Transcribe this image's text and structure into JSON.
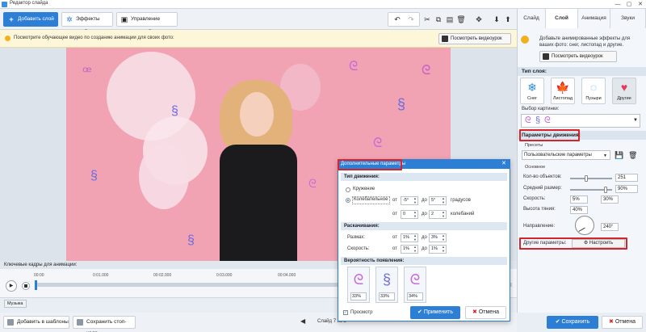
{
  "window": {
    "title": "Редактор слайда",
    "minimize": "—",
    "maximize": "▢",
    "close": "✕"
  },
  "toolbar": {
    "add_layer": "Добавить слой",
    "slide_effects": "Эффекты слайда",
    "camera_control": "Управление камерой",
    "icons": [
      "undo-icon",
      "redo-icon",
      "cut-icon",
      "copy-icon",
      "paste-icon",
      "delete-icon",
      "align-icon",
      "move-down-icon",
      "move-up-icon"
    ]
  },
  "notice": {
    "text": "Посмотрите обучающее видео по созданию анимации для своих фото:",
    "button": "Посмотреть видеоурок"
  },
  "keyframes": {
    "label": "Ключевые кадры для анимации:",
    "ticks": [
      "00:00",
      "0:01.000",
      "00:02.000",
      "0:03.000",
      "00:04.000"
    ],
    "music": "Музыка"
  },
  "bottom": {
    "add_template": "Добавить в шаблоны",
    "save_frame": "Сохранить стоп-кадр",
    "slide_info": "Слайд 7 из 8",
    "save": "Сохранить",
    "cancel": "Отмена"
  },
  "right": {
    "tabs": [
      "Слайд",
      "Слой",
      "Анимация",
      "Звуки"
    ],
    "active_tab": "Слой",
    "info_text": "Добавьте анимированные эффекты для ваших фото: снег, листопад и другие.",
    "info_button": "Посмотреть видеоурок",
    "layer_type_title": "Тип слоя:",
    "layer_types": [
      {
        "label": "Снег",
        "icon": "❄",
        "color": "#2d8fe0"
      },
      {
        "label": "Листопад",
        "icon": "🍁",
        "color": "#e68a1e"
      },
      {
        "label": "Пузыри",
        "icon": "◌",
        "color": "#5aa6e6"
      },
      {
        "label": "Другие",
        "icon": "♥",
        "color": "#e23b5c"
      }
    ],
    "picture_choice": "Выбор картинки:",
    "motion_title": "Параметры движения:",
    "presets_label": "Пресеты",
    "preset_value": "Пользовательские параметры",
    "basic_label": "Основное",
    "params": [
      {
        "label": "Кол-во объектов:",
        "value": "251"
      },
      {
        "label": "Средний размер:",
        "value": "90%"
      },
      {
        "label": "Скорость:",
        "value1": "5%",
        "value2": "30%"
      },
      {
        "label": "Высота тяния:",
        "value1": "40%"
      },
      {
        "label": "Направление:",
        "value": "240°"
      }
    ],
    "other_params": "Другие параметры:",
    "configure": "Настроить"
  },
  "dialog": {
    "title": "Дополнительные параметры",
    "motion_type": "Тип движения:",
    "spin_option": "Кружение",
    "osc_option": "Колебательное",
    "from": "от",
    "to": "до",
    "deg_from": "-5°",
    "deg_to": "5°",
    "degrees": "градусов",
    "osc_from": "0",
    "osc_to": "2",
    "oscillations": "колебаний",
    "swing_title": "Раскачивания:",
    "amplitude": "Размах:",
    "amp_from": "1%",
    "amp_to": "3%",
    "speed": "Скорость:",
    "spd_from": "1%",
    "spd_to": "1%",
    "prob_title": "Вероятность появления:",
    "probs": [
      "33%",
      "33%",
      "34%"
    ],
    "preview": "Просмотр",
    "apply": "Применить",
    "cancel": "Отмена"
  }
}
